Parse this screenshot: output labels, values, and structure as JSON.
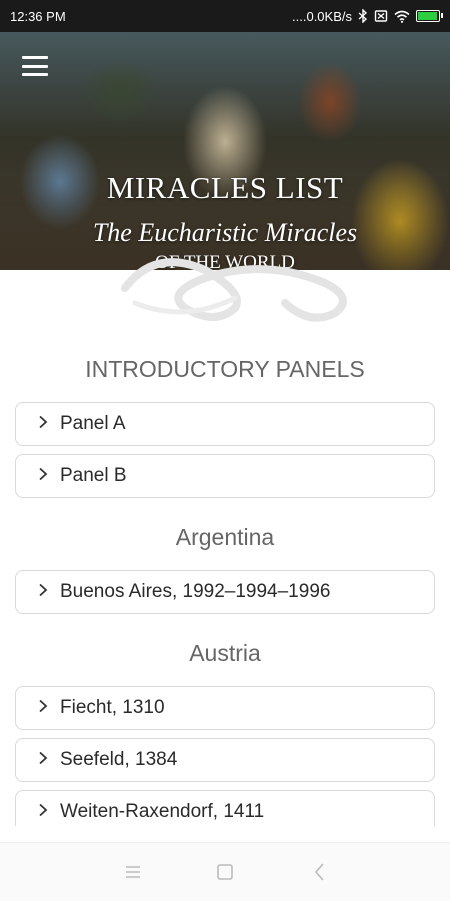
{
  "status_bar": {
    "time": "12:36 PM",
    "network_speed": "....0.0KB/s",
    "icons": [
      "bluetooth-icon",
      "no-sim-icon",
      "wifi-icon",
      "battery-icon"
    ]
  },
  "header": {
    "menu_icon": "hamburger-menu-icon",
    "title": "MIRACLES LIST",
    "subtitle": "The Eucharistic Miracles",
    "subtitle_line2": "OF THE WORLD"
  },
  "sections": [
    {
      "title": "INTRODUCTORY PANELS",
      "items": [
        "Panel A",
        "Panel B"
      ]
    },
    {
      "title": "Argentina",
      "items": [
        "Buenos Aires, 1992–1994–1996"
      ]
    },
    {
      "title": "Austria",
      "items": [
        "Fiecht, 1310",
        "Seefeld, 1384",
        "Weiten-Raxendorf, 1411"
      ]
    }
  ],
  "nav_bar": {
    "icons": [
      "recent-apps-icon",
      "home-icon",
      "back-icon"
    ]
  },
  "colors": {
    "status_bar_bg": "#1a1a1a",
    "item_border": "#d9d9d9",
    "section_title": "#666666"
  }
}
